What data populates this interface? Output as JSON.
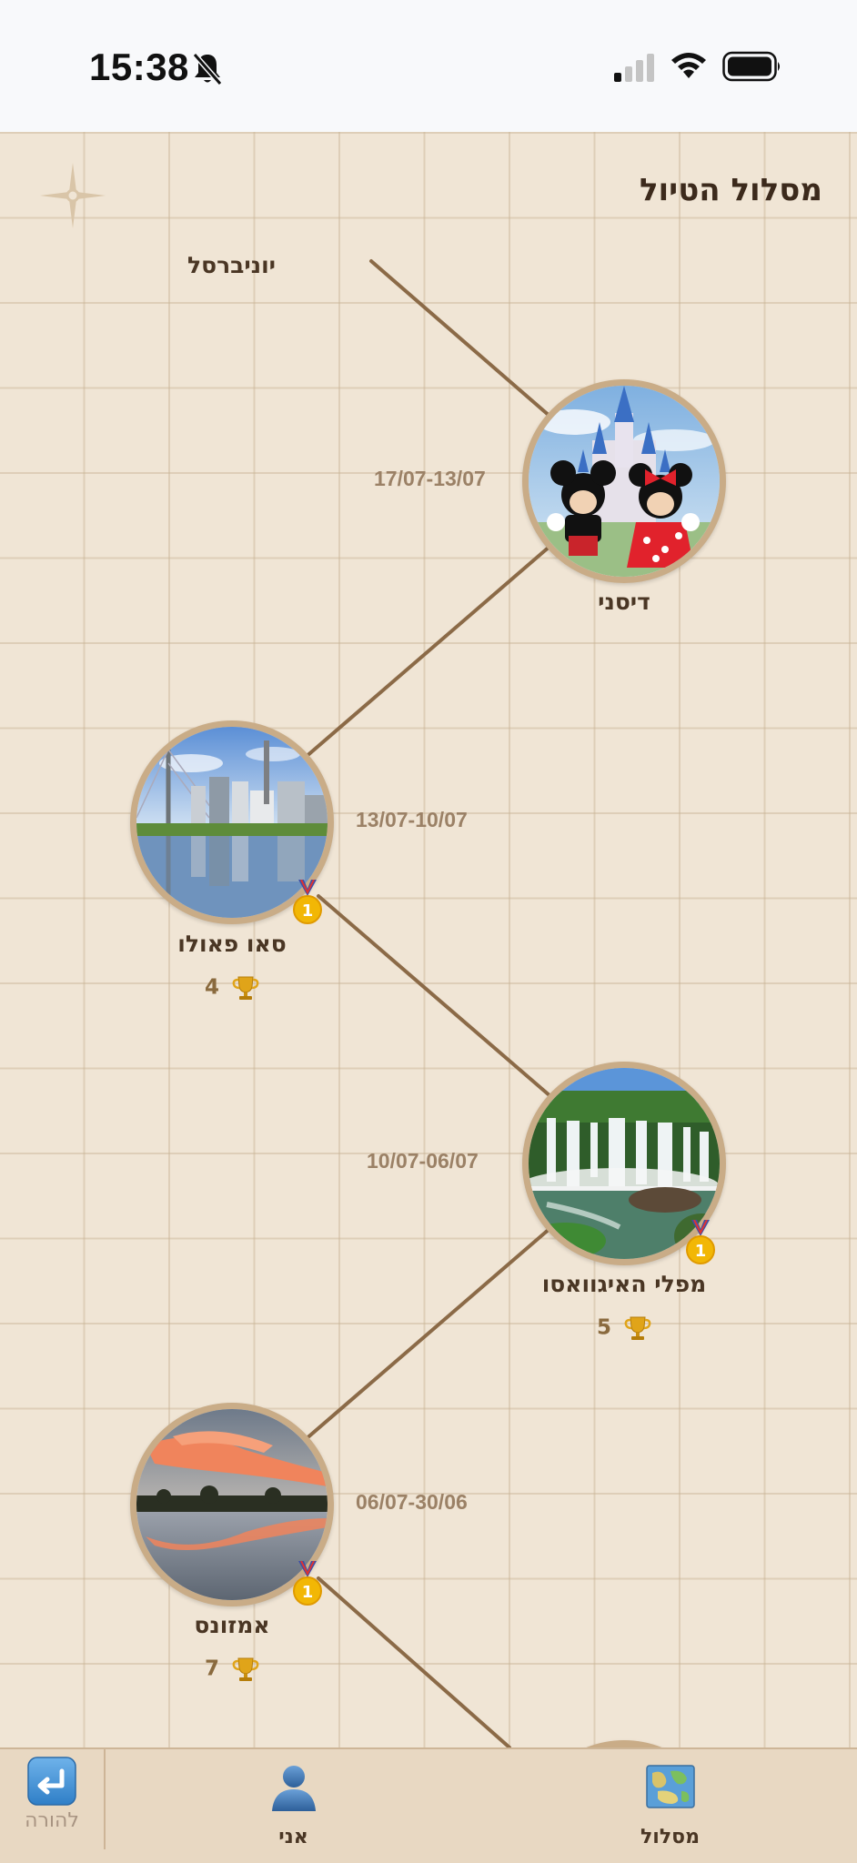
{
  "status_bar": {
    "time": "15:38"
  },
  "header": {
    "title": "מסלול הטיול"
  },
  "partial_stop": {
    "name": "יוניברסל"
  },
  "stops": [
    {
      "name": "דיסני",
      "dates": "17/07-13/07",
      "trophies": "",
      "medal": false
    },
    {
      "name": "סאו פאולו",
      "dates": "13/07-10/07",
      "trophies": "4",
      "medal": true
    },
    {
      "name": "מפלי האיגוואסו",
      "dates": "10/07-06/07",
      "trophies": "5",
      "medal": true
    },
    {
      "name": "אמזונס",
      "dates": "06/07-30/06",
      "trophies": "7",
      "medal": true
    }
  ],
  "tab_bar": {
    "route_label": "מסלול",
    "me_label": "אני",
    "back_label": "להורה"
  },
  "colors": {
    "background": "#f0e5d5",
    "path_line": "#8b6a47",
    "photo_border": "#c9ac87",
    "tab_bar": "#e8d8c2"
  }
}
